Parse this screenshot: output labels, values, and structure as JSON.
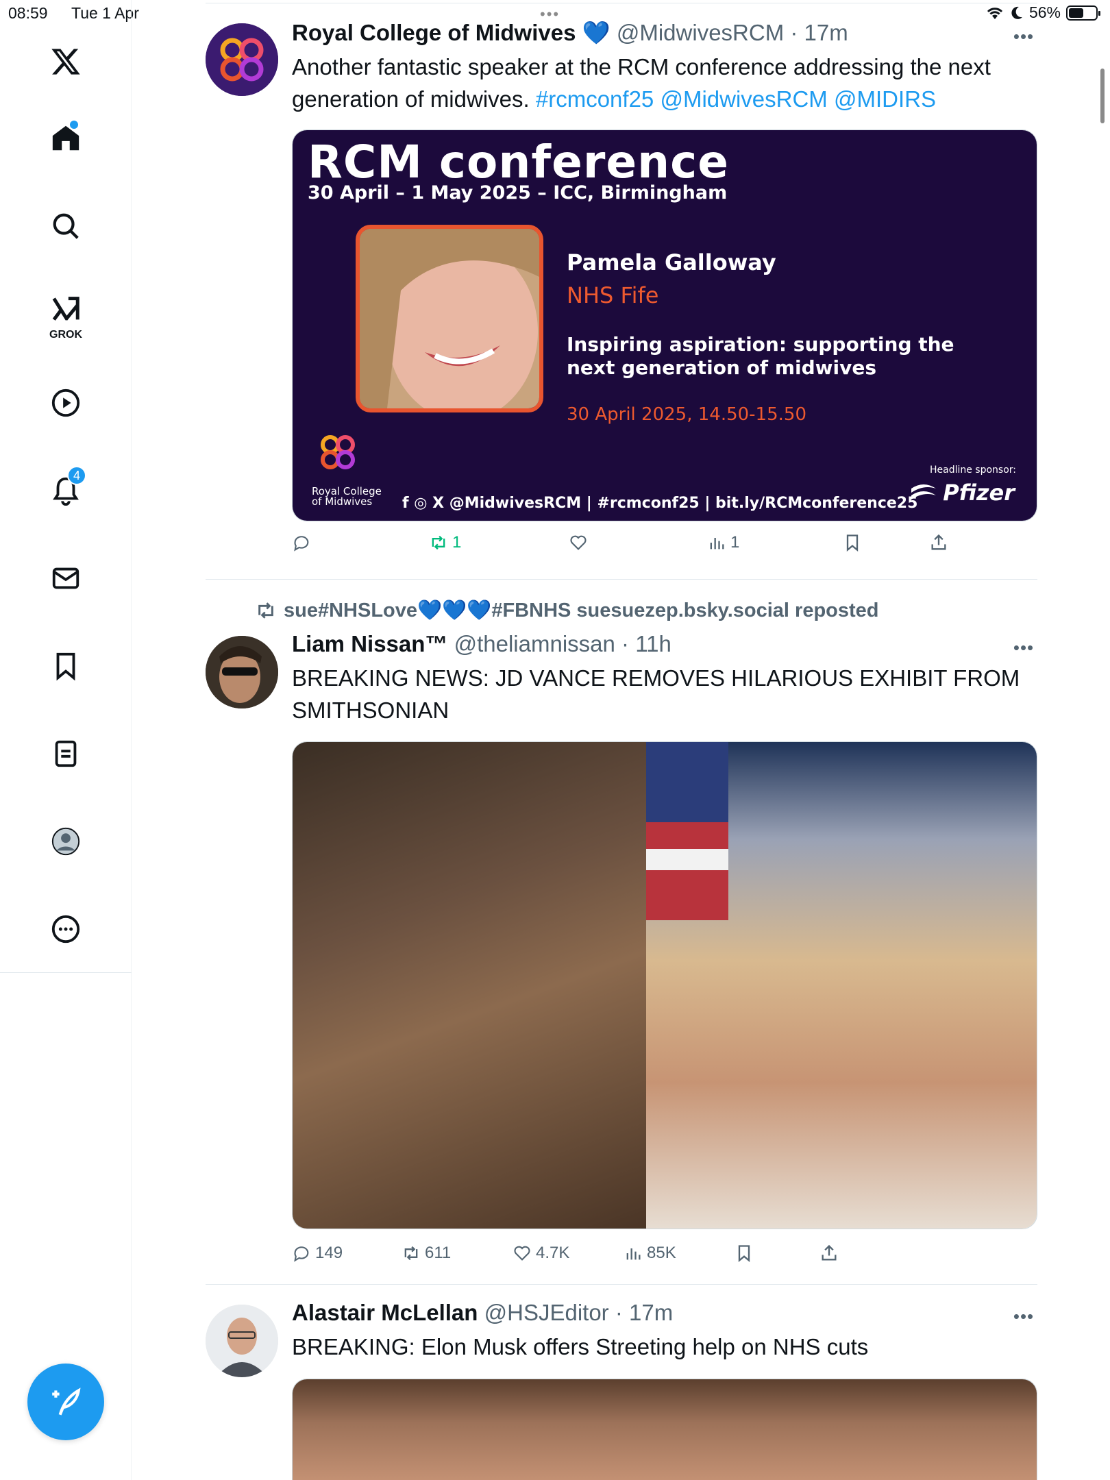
{
  "status_bar": {
    "time": "08:59",
    "date": "Tue 1 Apr",
    "battery": "56%",
    "battery_fraction": 0.56
  },
  "sidebar": {
    "grok_label": "GROK",
    "notifications_count": "4"
  },
  "posts": [
    {
      "name": "Royal College of Midwives 💙",
      "handle": "@MidwivesRCM",
      "time": "· 17m",
      "text_plain": "Another fantastic speaker at the RCM conference addressing the next generation of midwives. ",
      "hashtag": "#rcmconf25",
      "mention1": "@MidwivesRCM",
      "mention2": "@MIDIRS",
      "card": {
        "title": "RCM conference",
        "subtitle": "30 April – 1 May 2025 – ICC, Birmingham",
        "speaker": "Pamela Galloway",
        "org": "NHS Fife",
        "talk": "Inspiring aspiration: supporting the next generation of midwives",
        "when": "30 April 2025, 14.50-15.50",
        "logo_text_1": "Royal College",
        "logo_text_2": "of Midwives",
        "footer": "f ◎ X @MidwivesRCM  |  #rcmconf25  |  bit.ly/RCMconference25",
        "sponsor_label": "Headline sponsor:",
        "sponsor": "Pfizer"
      },
      "actions": {
        "replies": "",
        "reposts": "1",
        "likes": "",
        "views": "1"
      }
    },
    {
      "repost_by": "sue#NHSLove💙💙💙#FBNHS suesuezep.bsky.social reposted",
      "name": "Liam Nissan™",
      "handle": "@theliamnissan",
      "time": "· 11h",
      "text": "BREAKING NEWS: JD VANCE REMOVES HILARIOUS EXHIBIT FROM SMITHSONIAN",
      "actions": {
        "replies": "149",
        "reposts": "611",
        "likes": "4.7K",
        "views": "85K"
      }
    },
    {
      "name": "Alastair McLellan",
      "handle": "@HSJEditor",
      "time": "· 17m",
      "text": "BREAKING: Elon Musk offers Streeting help on NHS cuts"
    }
  ],
  "colors": {
    "accent": "#1d9bf0",
    "repost_green": "#00ba7c",
    "muted": "#536471",
    "card_bg": "#1c0a3c",
    "card_orange": "#ee5a2f"
  }
}
